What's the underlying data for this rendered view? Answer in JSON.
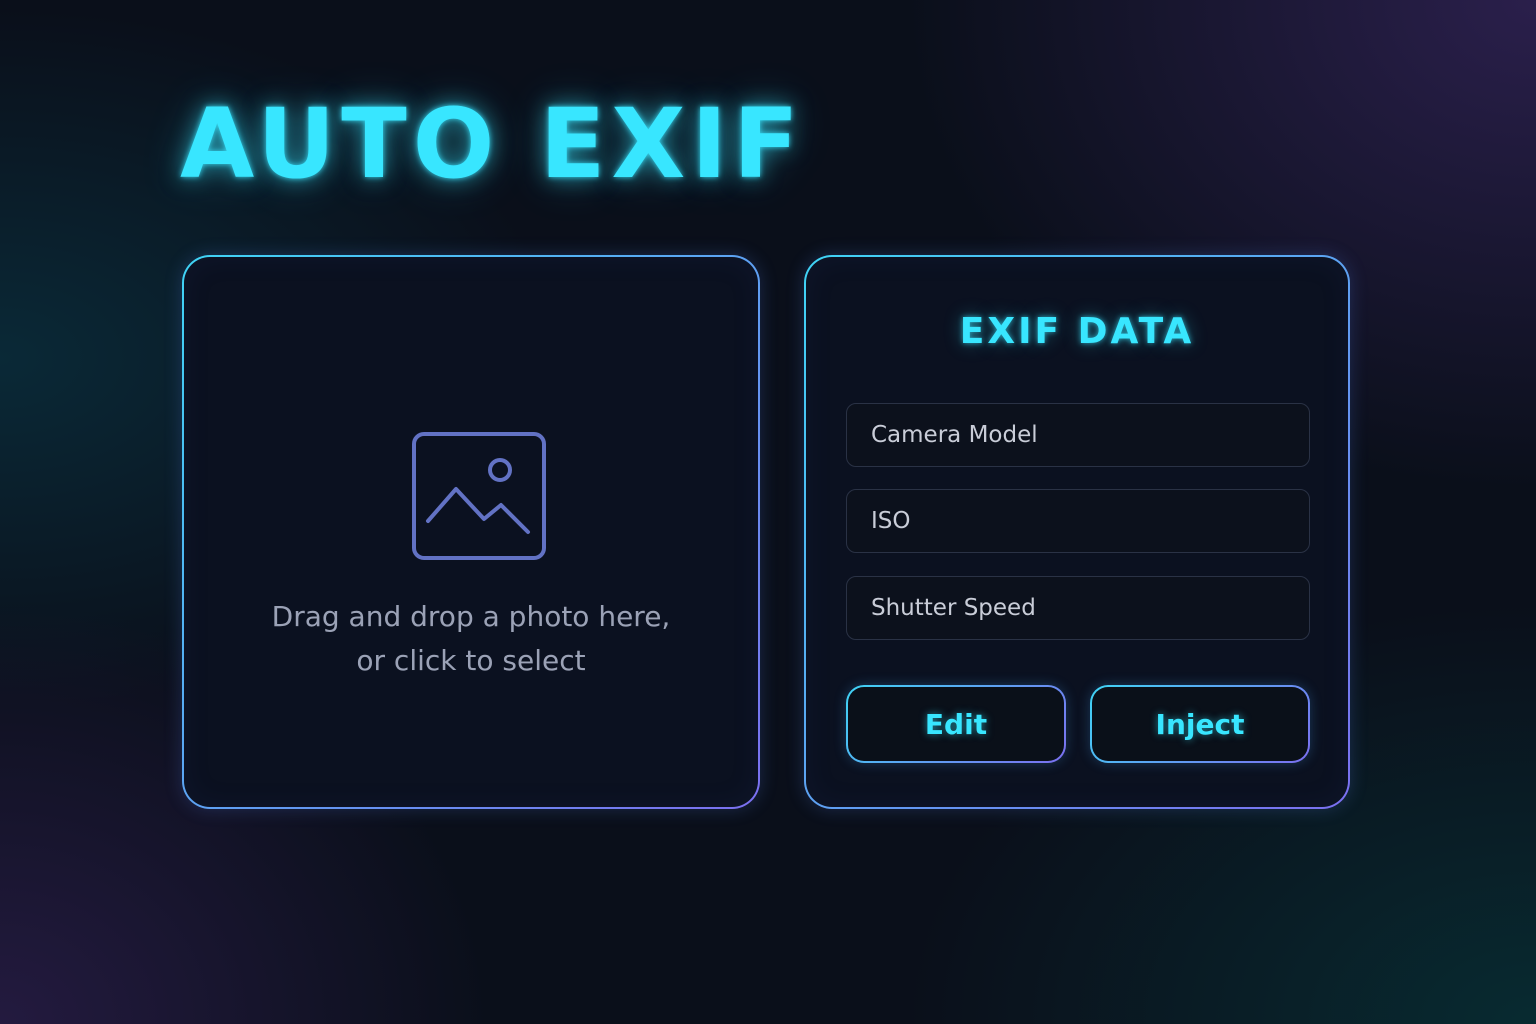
{
  "app": {
    "title": "AUTO EXIF"
  },
  "dropzone": {
    "icon": "image-icon",
    "line1": "Drag and drop a photo here,",
    "line2": "or click to select"
  },
  "exif": {
    "title": "EXIF DATA",
    "fields": {
      "camera_model": {
        "placeholder": "Camera Model",
        "value": ""
      },
      "iso": {
        "placeholder": "ISO",
        "value": ""
      },
      "shutter_speed": {
        "placeholder": "Shutter Speed",
        "value": ""
      }
    },
    "buttons": {
      "edit": "Edit",
      "inject": "Inject"
    }
  },
  "colors": {
    "accent": "#38e6ff",
    "border_gradient_start": "#3fd4f5",
    "border_gradient_end": "#7b6ff0",
    "panel_bg": "#0b1120",
    "muted_text": "#9ba2b6",
    "icon": "#6272c4"
  }
}
